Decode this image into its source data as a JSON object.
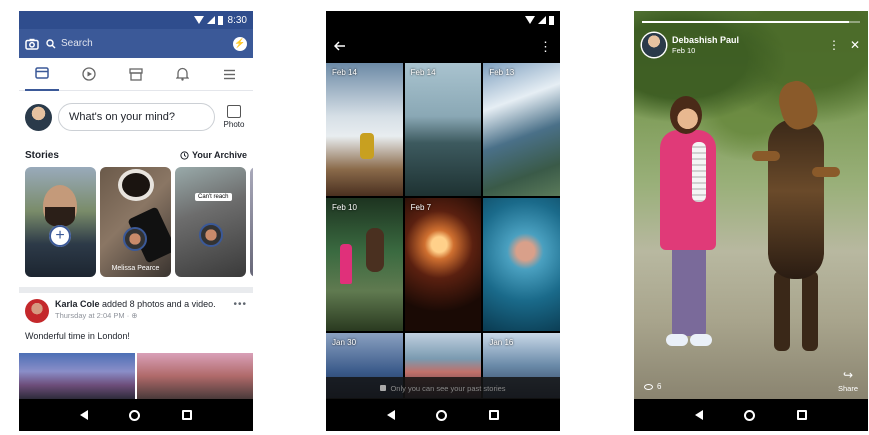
{
  "phone1": {
    "status": {
      "time": "8:30"
    },
    "header": {
      "search_placeholder": "Search"
    },
    "tabs": [
      "news-feed",
      "video",
      "marketplace",
      "notifications",
      "menu"
    ],
    "composer": {
      "placeholder": "What's on your mind?",
      "photo_label": "Photo"
    },
    "stories": {
      "title": "Stories",
      "archive_label": "Your Archive",
      "items": [
        {
          "name": ""
        },
        {
          "name": "Melissa Pearce"
        },
        {
          "name": "",
          "tag": "Can't reach"
        }
      ]
    },
    "post": {
      "author": "Karla Cole",
      "action": "added 8 photos and a video.",
      "time": "Thursday at 2:04 PM",
      "caption": "Wonderful time in London!"
    }
  },
  "phone2": {
    "tiles": [
      {
        "date": "Feb 14"
      },
      {
        "date": "Feb 14"
      },
      {
        "date": "Feb 13"
      },
      {
        "date": "Feb 10"
      },
      {
        "date": "Feb 7"
      },
      {
        "date": ""
      },
      {
        "date": "Jan 30"
      },
      {
        "date": ""
      },
      {
        "date": "Jan 16"
      }
    ],
    "privacy_note": "Only you can see your past stories"
  },
  "phone3": {
    "author": "Debashish Paul",
    "date": "Feb 10",
    "views": "6",
    "share_label": "Share",
    "progress": 0.95
  },
  "colors": {
    "facebook_blue": "#3b5998",
    "status_blue": "#2f4d8d"
  }
}
